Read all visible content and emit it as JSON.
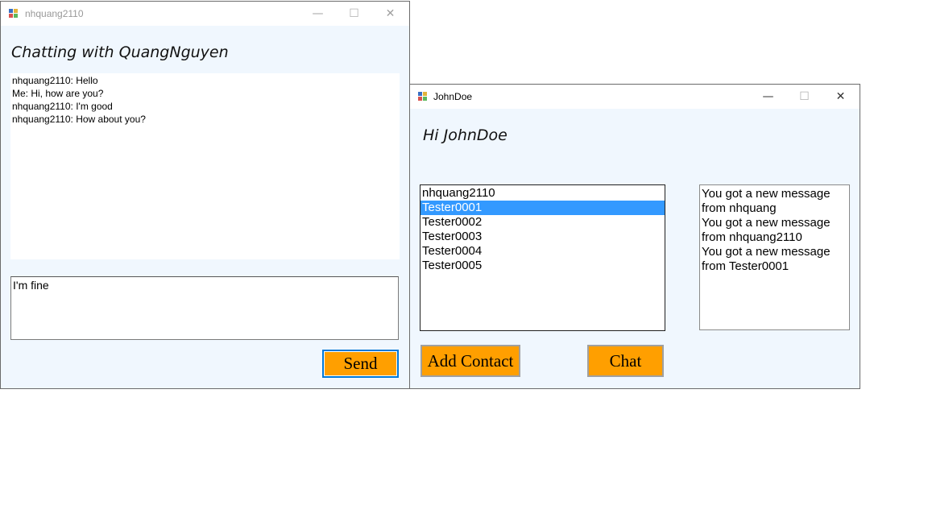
{
  "chat_window": {
    "title": "nhquang2110",
    "heading": "Chatting with QuangNguyen",
    "messages": [
      "nhquang2110: Hello",
      "Me: Hi, how are you?",
      "nhquang2110: I'm good",
      "nhquang2110: How about you?"
    ],
    "input_value": "I'm fine",
    "send_label": "Send",
    "controls": {
      "minimize": "—",
      "maximize": "☐",
      "close": "✕"
    }
  },
  "main_window": {
    "title": "JohnDoe",
    "heading": "Hi JohnDoe",
    "contacts": [
      "nhquang2110",
      "Tester0001",
      "Tester0002",
      "Tester0003",
      "Tester0004",
      "Tester0005"
    ],
    "selected_contact": "Tester0001",
    "notifications": [
      "You got a new message",
      "from nhquang",
      "You got a new message",
      "from nhquang2110",
      "You got a new message",
      "from Tester0001"
    ],
    "add_contact_label": "Add Contact",
    "chat_label": "Chat",
    "controls": {
      "minimize": "—",
      "maximize": "☐",
      "close": "✕"
    }
  },
  "colors": {
    "accent_button": "#ff9f00",
    "selection": "#3399ff",
    "window_bg": "#f0f7fe"
  },
  "icons": {
    "app_icon": "windows-forms-app-icon"
  }
}
